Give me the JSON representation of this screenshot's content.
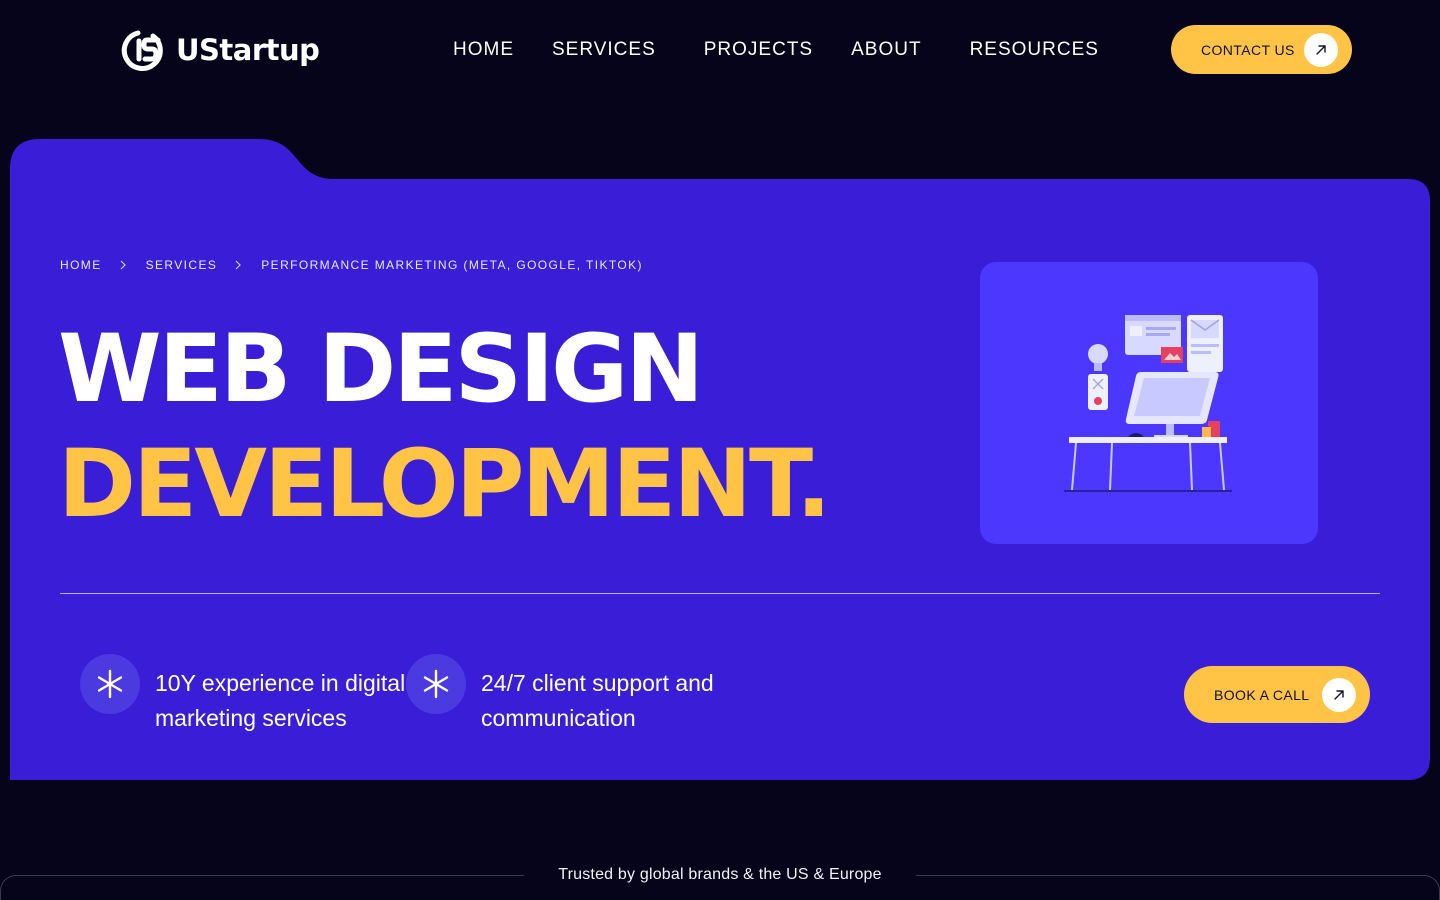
{
  "header": {
    "brand": "UStartup",
    "nav": [
      "HOME",
      "SERVICES",
      "PROJECTS",
      "ABOUT",
      "RESOURCES"
    ],
    "contact_label": "CONTACT US"
  },
  "hero": {
    "breadcrumb": [
      "HOME",
      "SERVICES",
      "PERFORMANCE MARKETING (META, GOOGLE, TIKTOK)"
    ],
    "title_line1": "WEB DESIGN",
    "title_line2": "DEVELOPMENT.",
    "features": [
      "10Y experience in digital marketing services",
      "24/7 client support and communication"
    ],
    "cta_label": "BOOK A CALL"
  },
  "trust": {
    "text": "Trusted by global brands & the US & Europe"
  },
  "colors": {
    "background": "#05041b",
    "hero": "#3a1ed7",
    "illustration_card": "#4b37ff",
    "accent": "#ffc446"
  },
  "icons": [
    "us-logo-icon",
    "arrow-up-right-icon",
    "chevron-right-icon",
    "asterisk-icon",
    "workspace-illustration"
  ]
}
